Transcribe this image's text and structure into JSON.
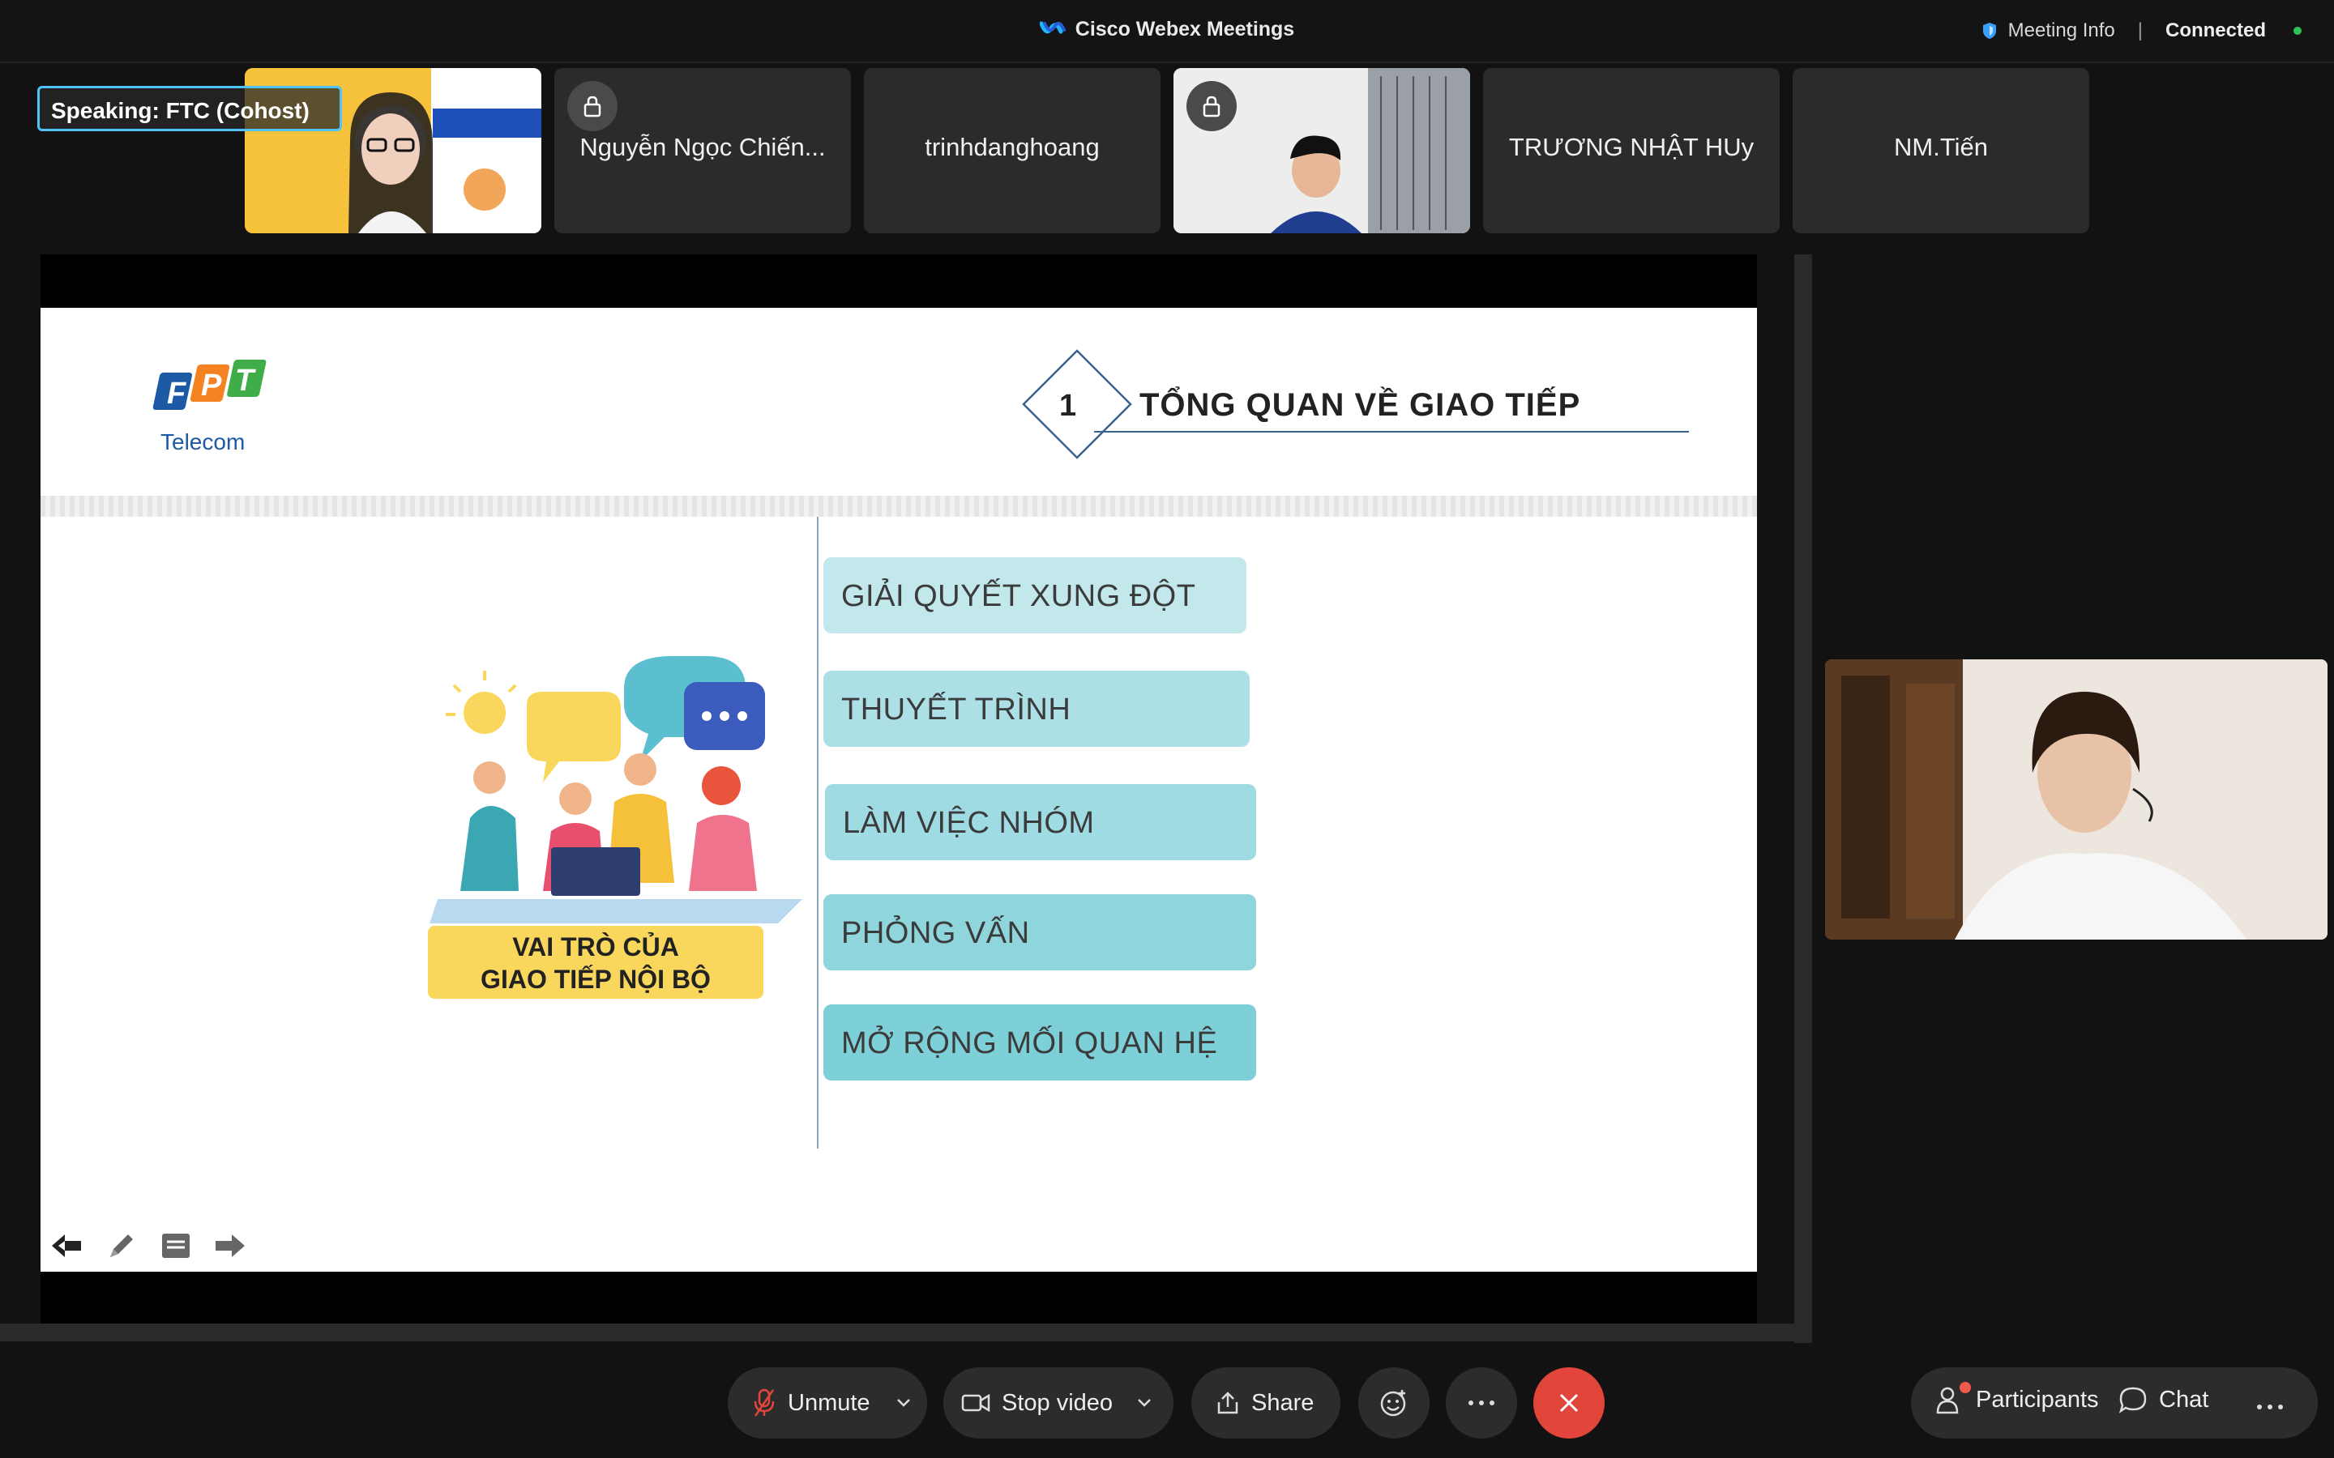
{
  "titlebar": {
    "app_title": "Cisco Webex Meetings",
    "meeting_info": "Meeting Info",
    "separator": "|",
    "status": "Connected"
  },
  "speaking": {
    "label": "Speaking:  FTC (Cohost)"
  },
  "participants": [
    {
      "name": "",
      "has_video": true
    },
    {
      "name": "Nguyễn Ngọc Chiến...",
      "locked": true
    },
    {
      "name": "trinhdanghoang"
    },
    {
      "name": "",
      "has_video": true,
      "locked": true
    },
    {
      "name": "TRƯƠNG NHẬT HUy"
    },
    {
      "name": "NM.Tiến"
    }
  ],
  "slide": {
    "logo_text": "FPT",
    "logo_sub": "Telecom",
    "section_number": "1",
    "section_title": "TỔNG QUAN VỀ GIAO TIẾP",
    "illustration_label_line1": "VAI TRÒ CỦA",
    "illustration_label_line2": "GIAO TIẾP NỘI BỘ",
    "items": [
      "GIẢI QUYẾT XUNG ĐỘT",
      "THUYẾT TRÌNH",
      "LÀM VIỆC NHÓM",
      "PHỎNG VẤN",
      "MỞ RỘNG MỐI QUAN HỆ"
    ]
  },
  "controls": {
    "unmute": "Unmute",
    "stop_video": "Stop video",
    "share": "Share",
    "participants": "Participants",
    "chat": "Chat"
  },
  "colors": {
    "accent_blue": "#4fc3f7",
    "end_red": "#e2463b",
    "box_teal_light": "#bfe6ea",
    "box_teal_dark": "#7fd1d8",
    "label_yellow": "#f8d75c"
  }
}
